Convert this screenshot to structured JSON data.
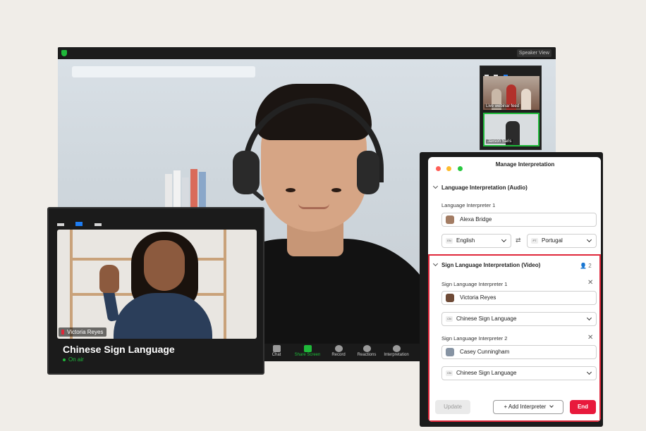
{
  "colors": {
    "accent_green": "#1fb93a",
    "alert_red": "#e0273a",
    "end_red": "#e8193c",
    "blue": "#1d7cf2"
  },
  "main_window": {
    "speaker_view_label": "Speaker View",
    "thumbnails": [
      {
        "label": "Live webinar feed"
      },
      {
        "label": "Jaxson Saris"
      }
    ],
    "toolbar": [
      {
        "label": "Chat",
        "icon": "chat-icon"
      },
      {
        "label": "Share Screen",
        "icon": "share-screen-icon"
      },
      {
        "label": "Record",
        "icon": "record-icon"
      },
      {
        "label": "Reactions",
        "icon": "reactions-icon"
      },
      {
        "label": "Interpretation",
        "icon": "globe-icon"
      }
    ]
  },
  "sign_window": {
    "name_tag": "Victoria Reyes",
    "language": "Chinese Sign Language",
    "status": "On air"
  },
  "dialog": {
    "title": "Manage Interpretation",
    "audio_section": {
      "heading": "Language Interpretation (Audio)",
      "interpreter_label": "Language Interpreter 1",
      "interpreter_name": "Alexa Bridge",
      "from_lang": {
        "code": "EN",
        "label": "English"
      },
      "to_lang": {
        "code": "PT",
        "label": "Portugal"
      },
      "swap_icon": "swap-icon"
    },
    "sign_section": {
      "heading": "Sign Language Interpretation (Video)",
      "count": "2",
      "interpreters": [
        {
          "label": "Sign Language Interpreter 1",
          "name": "Victoria Reyes",
          "lang_code": "CN",
          "language": "Chinese Sign Language"
        },
        {
          "label": "Sign Language Interpreter 2",
          "name": "Casey Cunningham",
          "lang_code": "CN",
          "language": "Chinese Sign Language"
        }
      ]
    },
    "buttons": {
      "update": "Update",
      "add": "+ Add Interpreter",
      "end": "End"
    }
  }
}
